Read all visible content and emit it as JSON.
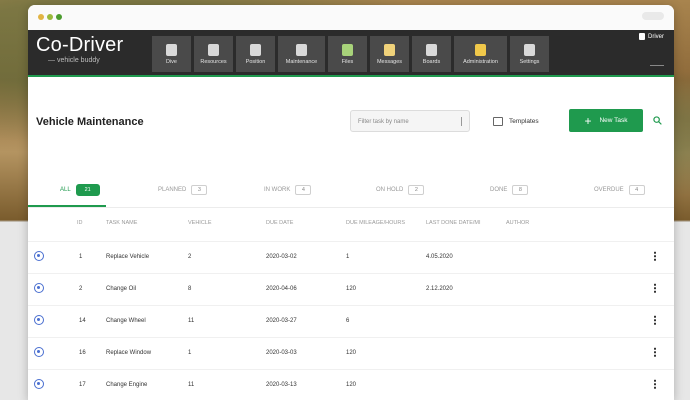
{
  "theme": {
    "accent": "#1f9a4e",
    "nav_bg": "#2b2b2b",
    "row_icon": "#4a6fd0"
  },
  "window": {
    "traffic_lights": [
      "#e2b443",
      "#9ab93c",
      "#4b9c2e"
    ]
  },
  "brand": {
    "name": "Co-Driver",
    "subtitle": "— vehicle buddy"
  },
  "nav": {
    "items": [
      {
        "label": "Dive",
        "icon": "driver-icon",
        "color": "#d9d9d9"
      },
      {
        "label": "Resources",
        "icon": "resources-icon",
        "color": "#d9d9d9"
      },
      {
        "label": "Position",
        "icon": "position-icon",
        "color": "#d9d9d9"
      },
      {
        "label": "Maintenance",
        "icon": "maintenance-icon",
        "color": "#d9d9d9"
      },
      {
        "label": "Files",
        "icon": "files-icon",
        "color": "#a8d37a"
      },
      {
        "label": "Messages",
        "icon": "messages-icon",
        "color": "#f0d27a"
      },
      {
        "label": "Boards",
        "icon": "boards-icon",
        "color": "#d9d9d9"
      },
      {
        "label": "Administration",
        "icon": "administration-icon",
        "color": "#f0c84a"
      },
      {
        "label": "Settings",
        "icon": "gear-icon",
        "color": "#d9d9d9"
      }
    ],
    "user_label": "Driver"
  },
  "page": {
    "title": "Vehicle Maintenance",
    "filter_placeholder": "Filter task by name",
    "templates_label": "Templates",
    "new_task_label": "New Task"
  },
  "tabs": [
    {
      "label": "ALL",
      "count": "21"
    },
    {
      "label": "PLANNED",
      "count": "3"
    },
    {
      "label": "IN WORK",
      "count": "4"
    },
    {
      "label": "ON HOLD",
      "count": "2"
    },
    {
      "label": "DONE",
      "count": "8"
    },
    {
      "label": "OVERDUE",
      "count": "4"
    }
  ],
  "table": {
    "columns": [
      "ID",
      "TASK NAME",
      "VEHICLE",
      "DUE DATE",
      "DUE MILEAGE/HOURS",
      "LAST DONE DATE/MI",
      "AUTHOR"
    ],
    "rows": [
      {
        "id": "1",
        "task": "Replace Vehicle",
        "vehicle": "2",
        "due": "2020-03-02",
        "mileage": "1",
        "last": "4.05.2020",
        "author": ""
      },
      {
        "id": "2",
        "task": "Change Oil",
        "vehicle": "8",
        "due": "2020-04-06",
        "mileage": "120",
        "last": "2.12.2020",
        "author": ""
      },
      {
        "id": "14",
        "task": "Change Wheel",
        "vehicle": "11",
        "due": "2020-03-27",
        "mileage": "6",
        "last": "",
        "author": ""
      },
      {
        "id": "16",
        "task": "Replace Window",
        "vehicle": "1",
        "due": "2020-03-03",
        "mileage": "120",
        "last": "",
        "author": ""
      },
      {
        "id": "17",
        "task": "Change Engine",
        "vehicle": "11",
        "due": "2020-03-13",
        "mileage": "120",
        "last": "",
        "author": ""
      }
    ]
  }
}
